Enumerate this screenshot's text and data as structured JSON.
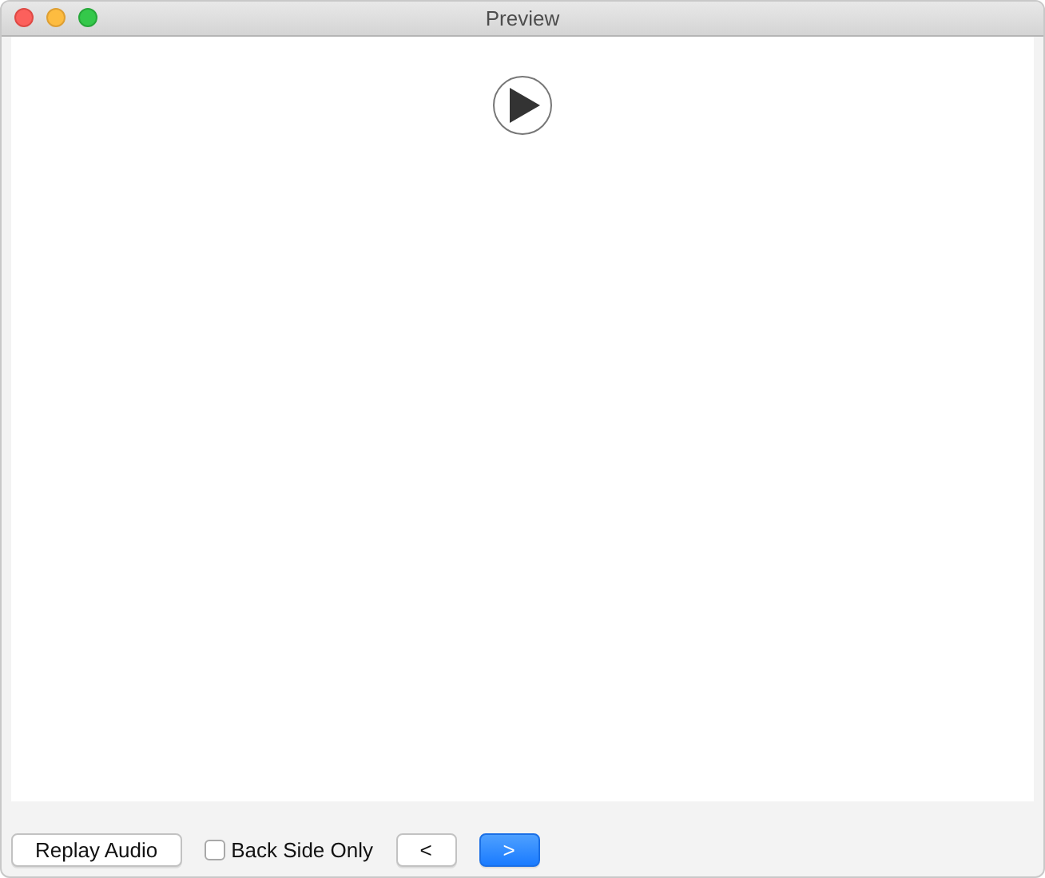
{
  "window": {
    "title": "Preview"
  },
  "controls": [
    {
      "kind": "button",
      "label": "Replay Audio",
      "default": false
    },
    {
      "kind": "checkbox",
      "label": "Back Side Only",
      "checked": false
    },
    {
      "kind": "button",
      "label": "<",
      "default": false
    },
    {
      "kind": "button",
      "label": ">",
      "default": true
    }
  ]
}
